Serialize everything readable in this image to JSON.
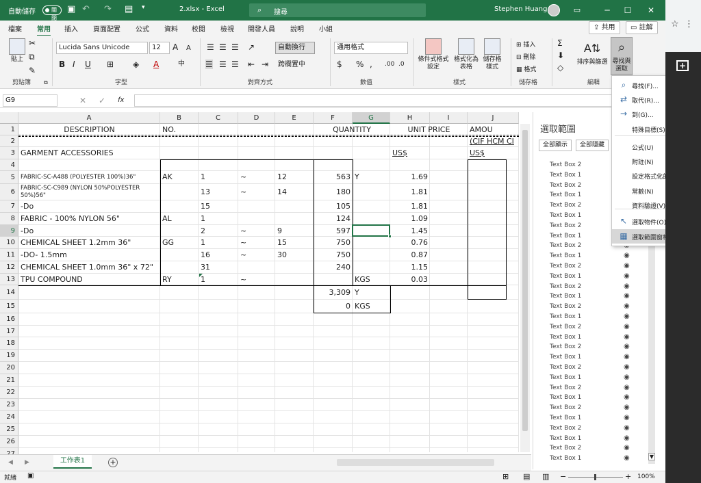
{
  "titlebar": {
    "autosave_label": "自動儲存",
    "autosave_state": "關閉",
    "filename": "2.xlsx - Excel",
    "search_placeholder": "搜尋",
    "user": "Stephen Huang"
  },
  "ribbon_tabs": [
    "檔案",
    "常用",
    "插入",
    "頁面配置",
    "公式",
    "資料",
    "校閱",
    "檢視",
    "開發人員",
    "說明",
    "小組"
  ],
  "share_label": "共用",
  "comments_label": "註解",
  "ribbon": {
    "paste_label": "貼上",
    "clipboard_group": "剪貼簿",
    "font_name": "Lucida Sans Unicode",
    "font_size": "12",
    "font_group": "字型",
    "wrap_text": "自動換行",
    "merge_center": "跨欄置中",
    "alignment_group": "對齊方式",
    "number_format": "通用格式",
    "number_group": "數值",
    "cond_format": [
      "條件式格式",
      "設定"
    ],
    "format_table": [
      "格式化為",
      "表格"
    ],
    "cell_styles": [
      "儲存格",
      "樣式"
    ],
    "styles_group": "樣式",
    "insert_label": "插入",
    "delete_label": "刪除",
    "format_label": "格式",
    "cells_group": "儲存格",
    "sort_filter": [
      "排序與篩選"
    ],
    "find_select": [
      "尋找與",
      "選取"
    ],
    "editing_group": "編輯"
  },
  "formula_bar": {
    "cell_ref": "G9",
    "fx": "fx"
  },
  "columns": [
    "A",
    "B",
    "C",
    "D",
    "E",
    "F",
    "G",
    "H",
    "I",
    "J"
  ],
  "rows": [
    "1",
    "2",
    "3",
    "4",
    "5",
    "6",
    "7",
    "8",
    "9",
    "10",
    "11",
    "12",
    "13",
    "14",
    "15",
    "16",
    "17",
    "18",
    "19",
    "20",
    "21",
    "22",
    "23",
    "24",
    "25",
    "26",
    "27"
  ],
  "cells": {
    "r1": {
      "a": "DESCRIPTION",
      "b": "NO.",
      "f": "QUANTITY",
      "h": "UNIT PRICE",
      "j": "AMOU"
    },
    "r2": {
      "j": "(CIF HCM CI"
    },
    "r3": {
      "a": "GARMENT ACCESSORIES",
      "h": "US$",
      "j": "US$"
    },
    "r5": {
      "a": "FABRIC-SC-A488 (POLYESTER 100%)36\"",
      "b": "AK",
      "c": "1",
      "d": "~",
      "e": "12",
      "f": "563",
      "g": "Y",
      "h": "1.69"
    },
    "r6": {
      "a1": "FABRIC-SC-C989 (NYLON 50%POLYESTER",
      "a2": "50%)56\"",
      "c": "13",
      "d": "~",
      "e": "14",
      "f": "180",
      "h": "1.81"
    },
    "r7": {
      "a": "-Do",
      "c": "15",
      "f": "105",
      "h": "1.81"
    },
    "r8": {
      "a": "FABRIC - 100% NYLON 56\"",
      "b": "AL",
      "c": "1",
      "f": "124",
      "h": "1.09"
    },
    "r9": {
      "a": "-Do",
      "c": "2",
      "d": "~",
      "e": "9",
      "f": "597",
      "h": "1.45"
    },
    "r10": {
      "a": "CHEMICAL SHEET 1.2mm 36\"",
      "b": "GG",
      "c": "1",
      "d": "~",
      "e": "15",
      "f": "750",
      "h": "0.76"
    },
    "r11": {
      "a": "-DO-  1.5mm",
      "c": "16",
      "d": "~",
      "e": "30",
      "f": "750",
      "h": "0.87"
    },
    "r12": {
      "a": "CHEMICAL SHEET 1.0mm 36\" x 72\"",
      "c": "31",
      "f": "240",
      "h": "1.15"
    },
    "r13": {
      "a": "TPU COMPOUND",
      "b": "RY",
      "c": "1",
      "d": "~",
      "g": "KGS",
      "h": "0.03"
    },
    "r14": {
      "f": "3,309",
      "g": "Y"
    },
    "r15": {
      "f": "0",
      "g": "KGS"
    }
  },
  "sheet_tab": "工作表1",
  "status": {
    "ready": "就緒",
    "zoom": "100%"
  },
  "selection_pane": {
    "title": "選取範圍",
    "show_all": "全部顯示",
    "hide_all": "全部隱藏",
    "items": [
      "Text Box 2",
      "Text Box 1",
      "Text Box 2",
      "Text Box 1",
      "Text Box 2",
      "Text Box 1",
      "Text Box 2",
      "Text Box 1",
      "Text Box 2",
      "Text Box 1",
      "Text Box 2",
      "Text Box 1",
      "Text Box 2",
      "Text Box 1",
      "Text Box 2",
      "Text Box 1",
      "Text Box 2",
      "Text Box 1",
      "Text Box 2",
      "Text Box 1",
      "Text Box 2",
      "Text Box 1",
      "Text Box 2",
      "Text Box 1",
      "Text Box 2",
      "Text Box 1",
      "Text Box 2",
      "Text Box 1",
      "Text Box 2",
      "Text Box 1"
    ]
  },
  "menu": [
    {
      "label": "尋找(F)...",
      "icon": "⌕"
    },
    {
      "label": "取代(R)...",
      "icon": "⇄"
    },
    {
      "label": "到(G)...",
      "icon": "→"
    },
    {
      "label": "特殊目標(S)...",
      "icon": ""
    },
    {
      "label": "公式(U)",
      "icon": ""
    },
    {
      "label": "附註(N)",
      "icon": ""
    },
    {
      "label": "設定格式化的條件(C)",
      "icon": ""
    },
    {
      "label": "常數(N)",
      "icon": ""
    },
    {
      "label": "資料驗證(V)",
      "icon": ""
    },
    {
      "label": "選取物件(O)",
      "icon": "↖"
    },
    {
      "label": "選取範圍窗格(P)...",
      "icon": "▦"
    }
  ]
}
